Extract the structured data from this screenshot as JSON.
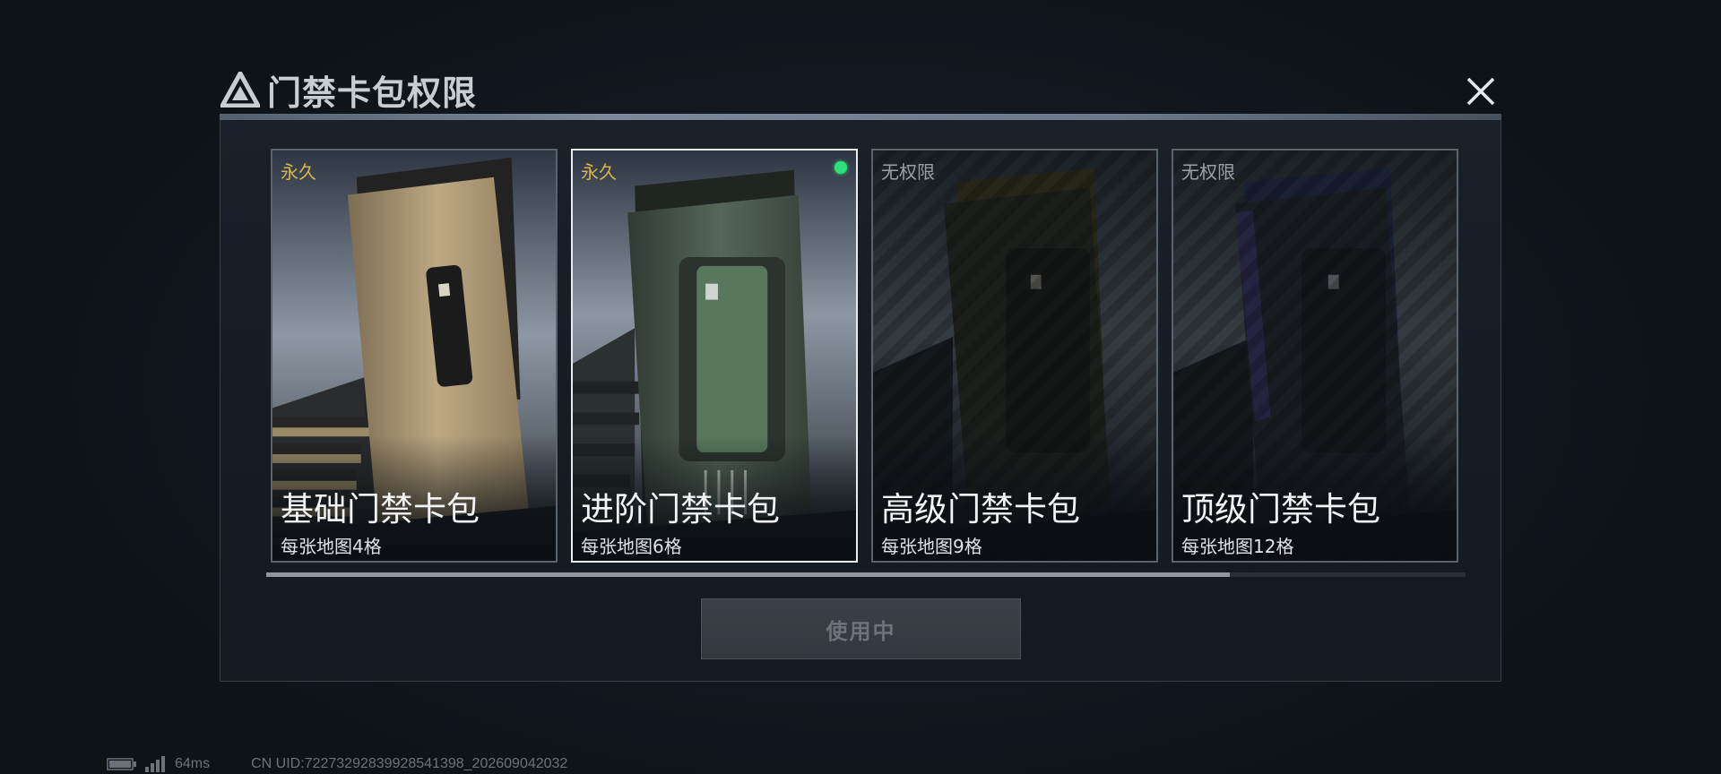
{
  "dialog": {
    "title": "门禁卡包权限",
    "close_icon": "close-icon"
  },
  "cards": [
    {
      "status": "永久",
      "name": "基础门禁卡包",
      "capacity": "每张地图4格",
      "selected": false,
      "unlocked": true,
      "accent": "#b6a27c"
    },
    {
      "status": "永久",
      "name": "进阶门禁卡包",
      "capacity": "每张地图6格",
      "selected": true,
      "unlocked": true,
      "accent": "#4d5f4f"
    },
    {
      "status": "无权限",
      "name": "高级门禁卡包",
      "capacity": "每张地图9格",
      "selected": false,
      "unlocked": false,
      "accent": "#5a5530"
    },
    {
      "status": "无权限",
      "name": "顶级门禁卡包",
      "capacity": "每张地图12格",
      "selected": false,
      "unlocked": false,
      "accent": "#2f3a5a"
    }
  ],
  "action": {
    "label": "使用中"
  },
  "footer": {
    "ping": "64ms",
    "uid": "CN UID:7227329283992854139­8_202609042032"
  },
  "colors": {
    "status_permanent": "#d9b64a",
    "status_none": "#9aa0a8",
    "selected_dot": "#2ee07a"
  }
}
